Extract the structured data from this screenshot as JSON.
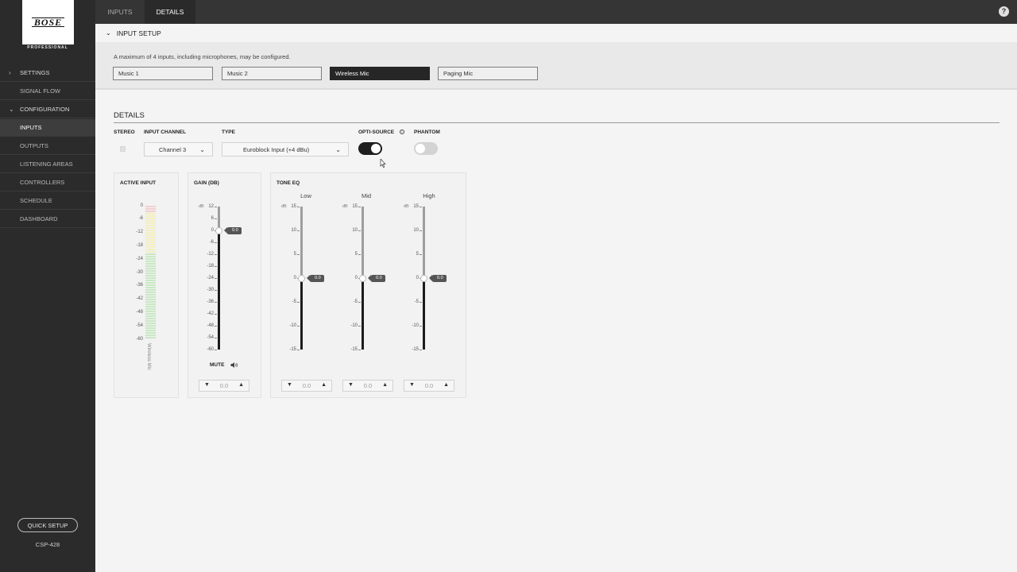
{
  "sidebar": {
    "brand": "BOSE",
    "brand_sub": "PROFESSIONAL",
    "items": [
      {
        "label": "SETTINGS",
        "icon": "chevron-right-icon"
      },
      {
        "label": "SIGNAL FLOW"
      },
      {
        "label": "CONFIGURATION",
        "icon": "chevron-down-icon"
      },
      {
        "label": "INPUTS",
        "active": true
      },
      {
        "label": "OUTPUTS"
      },
      {
        "label": "LISTENING AREAS"
      },
      {
        "label": "CONTROLLERS"
      },
      {
        "label": "SCHEDULE"
      },
      {
        "label": "DASHBOARD"
      }
    ],
    "quick_setup": "QUICK SETUP",
    "device": "CSP-428"
  },
  "topbar": {
    "tabs": [
      {
        "label": "INPUTS"
      },
      {
        "label": "DETAILS",
        "active": true
      }
    ],
    "help_icon": "?"
  },
  "input_setup": {
    "title": "INPUT SETUP",
    "note": "A maximum of 4 inputs, including microphones, may be configured.",
    "inputs": [
      "Music 1",
      "Music 2",
      "Wireless Mic",
      "Paging Mic"
    ],
    "selected": "Wireless Mic"
  },
  "details": {
    "title": "DETAILS",
    "labels": {
      "stereo": "STEREO",
      "input_channel": "INPUT CHANNEL",
      "type": "TYPE",
      "opti_source": "OPTI-SOURCE",
      "phantom": "PHANTOM"
    },
    "input_channel": "Channel 3",
    "type": "Euroblock Input (+4 dBu)",
    "opti_source_on": true,
    "phantom_on": false,
    "stereo_checked": false
  },
  "active_input": {
    "title": "ACTIVE INPUT",
    "scale": [
      "0",
      "-6",
      "-12",
      "-18",
      "-24",
      "-30",
      "-36",
      "-42",
      "-48",
      "-54",
      "-60"
    ],
    "channel_name": "Wireless Mic"
  },
  "gain": {
    "title": "GAIN (dB)",
    "unit": "dB",
    "scale": [
      "12",
      "6",
      "0",
      "-6",
      "-12",
      "-18",
      "-24",
      "-30",
      "-36",
      "-42",
      "-48",
      "-54",
      "-60"
    ],
    "value": "0.0",
    "value_db": 0,
    "mute_label": "MUTE",
    "stepper_value": "0.0"
  },
  "tone_eq": {
    "title": "TONE EQ",
    "unit": "dB",
    "scale": [
      "15",
      "10",
      "5",
      "0",
      "-5",
      "-10",
      "-15"
    ],
    "bands": [
      {
        "label": "Low",
        "value": "0.0",
        "value_db": 0,
        "stepper_value": "0.0"
      },
      {
        "label": "Mid",
        "value": "0.0",
        "value_db": 0,
        "stepper_value": "0.0"
      },
      {
        "label": "High",
        "value": "0.0",
        "value_db": 0,
        "stepper_value": "0.0"
      }
    ]
  },
  "colors": {
    "sidebar_bg": "#2b2b2b",
    "topbar_bg": "#353535",
    "selected_input": "#262626",
    "toggle_on": "#1e1e1e",
    "toggle_off": "#d3d3d3",
    "meter_green": "#c9e8c4",
    "meter_yellow": "#f3efc2",
    "meter_red": "#f3cfcf"
  }
}
